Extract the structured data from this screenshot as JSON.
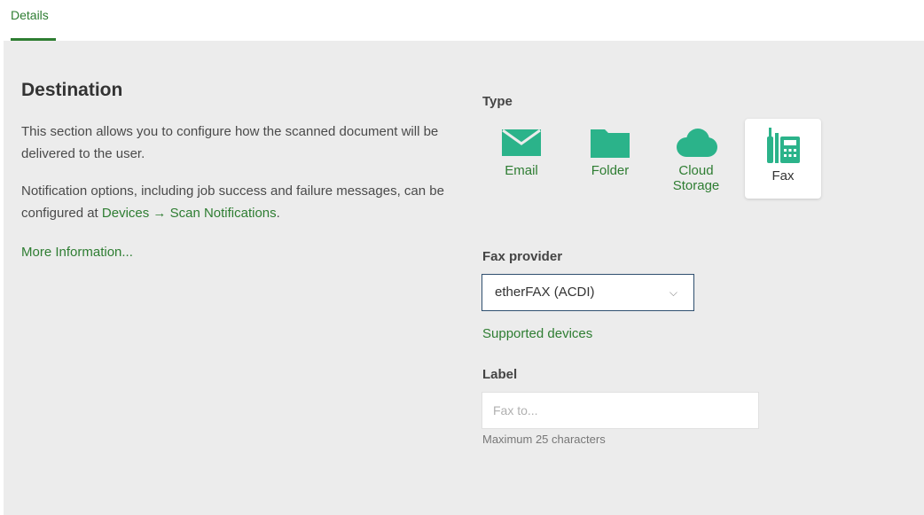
{
  "tabs": {
    "details": "Details"
  },
  "destination": {
    "heading": "Destination",
    "description1": "This section allows you to configure how the scanned document will be delivered to the user.",
    "description2_prefix": "Notification options, including job success and failure messages, can be configured at ",
    "description2_link": "Devices → Scan Notifications",
    "description2_suffix": ".",
    "more_info": "More Information..."
  },
  "type": {
    "label": "Type",
    "options": [
      {
        "name": "Email",
        "icon": "envelope-icon",
        "selected": false
      },
      {
        "name": "Folder",
        "icon": "folder-icon",
        "selected": false
      },
      {
        "name_line1": "Cloud",
        "name_line2": "Storage",
        "icon": "cloud-icon",
        "selected": false
      },
      {
        "name": "Fax",
        "icon": "fax-icon",
        "selected": true
      }
    ]
  },
  "fax_provider": {
    "label": "Fax provider",
    "value": "etherFAX (ACDI)",
    "supported_link": "Supported devices"
  },
  "label_field": {
    "label": "Label",
    "placeholder": "Fax to...",
    "hint": "Maximum 25 characters"
  },
  "colors": {
    "accent": "#2e7d32",
    "icon_teal": "#2bb38a",
    "panel_bg": "#ececec"
  }
}
